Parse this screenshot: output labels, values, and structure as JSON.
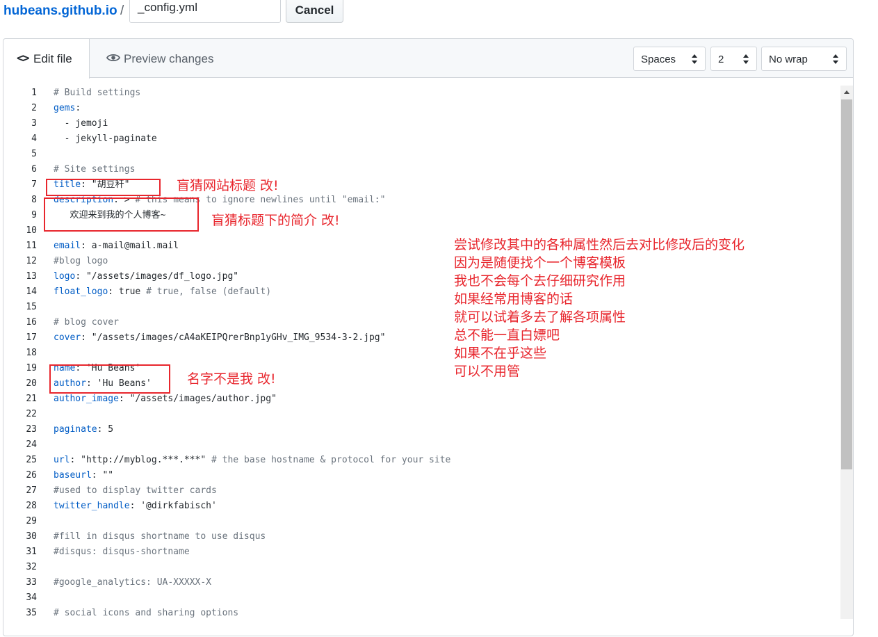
{
  "header": {
    "repo": "hubeans.github.io",
    "separator": "/",
    "filename": "_config.yml",
    "cancel_label": "Cancel"
  },
  "tabs": {
    "edit_icon": "<>",
    "edit_label": "Edit file",
    "preview_label": "Preview changes"
  },
  "options": {
    "indent_mode": "Spaces",
    "indent_size": "2",
    "wrap_mode": "No wrap"
  },
  "code_lines": [
    {
      "n": "1",
      "text": "# Build settings"
    },
    {
      "n": "2",
      "text": "gems:"
    },
    {
      "n": "3",
      "text": "  - jemoji"
    },
    {
      "n": "4",
      "text": "  - jekyll-paginate"
    },
    {
      "n": "5",
      "text": ""
    },
    {
      "n": "6",
      "text": "# Site settings"
    },
    {
      "n": "7",
      "text": "title: \"胡豆秆\""
    },
    {
      "n": "8",
      "text": "description: > # this means to ignore newlines until \"email:\""
    },
    {
      "n": "9",
      "text": "   欢迎来到我的个人博客~"
    },
    {
      "n": "10",
      "text": ""
    },
    {
      "n": "11",
      "text": "email: a-mail@mail.mail"
    },
    {
      "n": "12",
      "text": "#blog logo"
    },
    {
      "n": "13",
      "text": "logo: \"/assets/images/df_logo.jpg\""
    },
    {
      "n": "14",
      "text": "float_logo: true # true, false (default)"
    },
    {
      "n": "15",
      "text": ""
    },
    {
      "n": "16",
      "text": "# blog cover"
    },
    {
      "n": "17",
      "text": "cover: \"/assets/images/cA4aKEIPQrerBnp1yGHv_IMG_9534-3-2.jpg\""
    },
    {
      "n": "18",
      "text": ""
    },
    {
      "n": "19",
      "text": "name: 'Hu Beans'"
    },
    {
      "n": "20",
      "text": "author: 'Hu Beans'"
    },
    {
      "n": "21",
      "text": "author_image: \"/assets/images/author.jpg\""
    },
    {
      "n": "22",
      "text": ""
    },
    {
      "n": "23",
      "text": "paginate: 5"
    },
    {
      "n": "24",
      "text": ""
    },
    {
      "n": "25",
      "text": "url: \"http://myblog.***.***\" # the base hostname & protocol for your site"
    },
    {
      "n": "26",
      "text": "baseurl: \"\""
    },
    {
      "n": "27",
      "text": "#used to display twitter cards"
    },
    {
      "n": "28",
      "text": "twitter_handle: '@dirkfabisch'"
    },
    {
      "n": "29",
      "text": ""
    },
    {
      "n": "30",
      "text": "#fill in disqus shortname to use disqus"
    },
    {
      "n": "31",
      "text": "#disqus: disqus-shortname"
    },
    {
      "n": "32",
      "text": ""
    },
    {
      "n": "33",
      "text": "#google_analytics: UA-XXXXX-X"
    },
    {
      "n": "34",
      "text": ""
    },
    {
      "n": "35",
      "text": "# social icons and sharing options"
    }
  ],
  "annotations": {
    "title_note": "盲猜网站标题 改!",
    "description_note": "盲猜标题下的简介 改!",
    "name_note": "名字不是我 改!",
    "side_notes": [
      "尝试修改其中的各种属性然后去对比修改后的变化",
      "因为是随便找个一个博客模板",
      "我也不会每个去仔细研究作用",
      "如果经常用博客的话",
      "就可以试着多去了解各项属性",
      "总不能一直白嫖吧",
      "如果不在乎这些",
      "可以不用管"
    ]
  },
  "colors": {
    "link": "#0366d6",
    "key": "#005cc5",
    "string": "#032f62",
    "comment": "#6a737d",
    "annotation": "#e8262d"
  }
}
